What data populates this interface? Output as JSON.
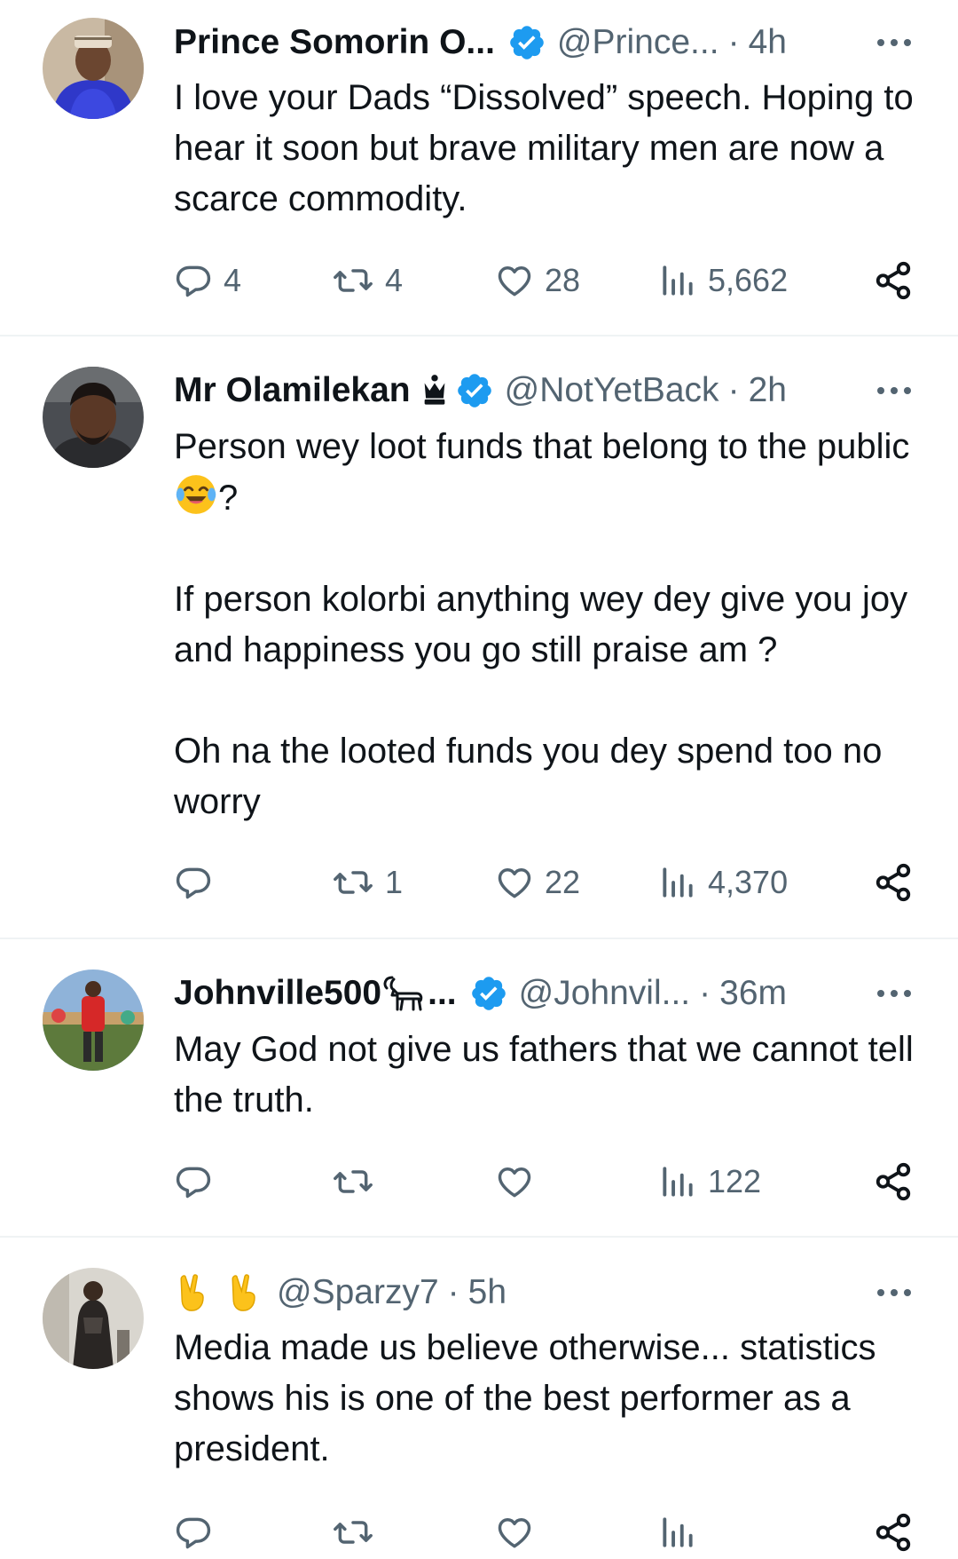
{
  "tweets": [
    {
      "name": "Prince Somorin O...",
      "handle": "@Prince...",
      "time": "4h",
      "text": [
        "I love your Dads “Dissolved” speech. Hoping to hear it soon but brave military men are now a scarce commodity."
      ],
      "replies": "4",
      "retweets": "4",
      "likes": "28",
      "views": "5,662"
    },
    {
      "name": "Mr Olamilekan",
      "handle": "@NotYetBack",
      "time": "2h",
      "text_prefix": "Person wey loot funds that belong to the public ",
      "text_suffix": "?",
      "text_rest": [
        "If person kolorbi anything wey dey give you joy and happiness you go still praise am ?",
        "Oh na the looted funds you dey spend too no worry"
      ],
      "replies": "",
      "retweets": "1",
      "likes": "22",
      "views": "4,370"
    },
    {
      "name": "Johnville500",
      "name_suffix": "...",
      "handle": "@Johnvil...",
      "time": "36m",
      "text": [
        "May God not give us fathers that we cannot tell the truth."
      ],
      "replies": "",
      "retweets": "",
      "likes": "",
      "views": "122"
    },
    {
      "name": "",
      "handle": "@Sparzy7",
      "time": "5h",
      "text": [
        "Media made us believe otherwise... statistics shows his is one of the best performer as a president."
      ]
    }
  ],
  "separator": "·",
  "icons": {
    "verified": "verified-badge-icon",
    "more": "more-icon",
    "reply": "reply-icon",
    "retweet": "retweet-icon",
    "like": "like-icon",
    "views": "views-icon",
    "share": "share-icon",
    "crown": "crown-icon",
    "goat": "goat-icon",
    "laugh": "laughing-crying-emoji",
    "victory": "victory-hand-emoji"
  },
  "colors": {
    "text": "#0f1419",
    "muted": "#536471",
    "verified": "#1d9bf0",
    "divider": "#eff3f4"
  }
}
